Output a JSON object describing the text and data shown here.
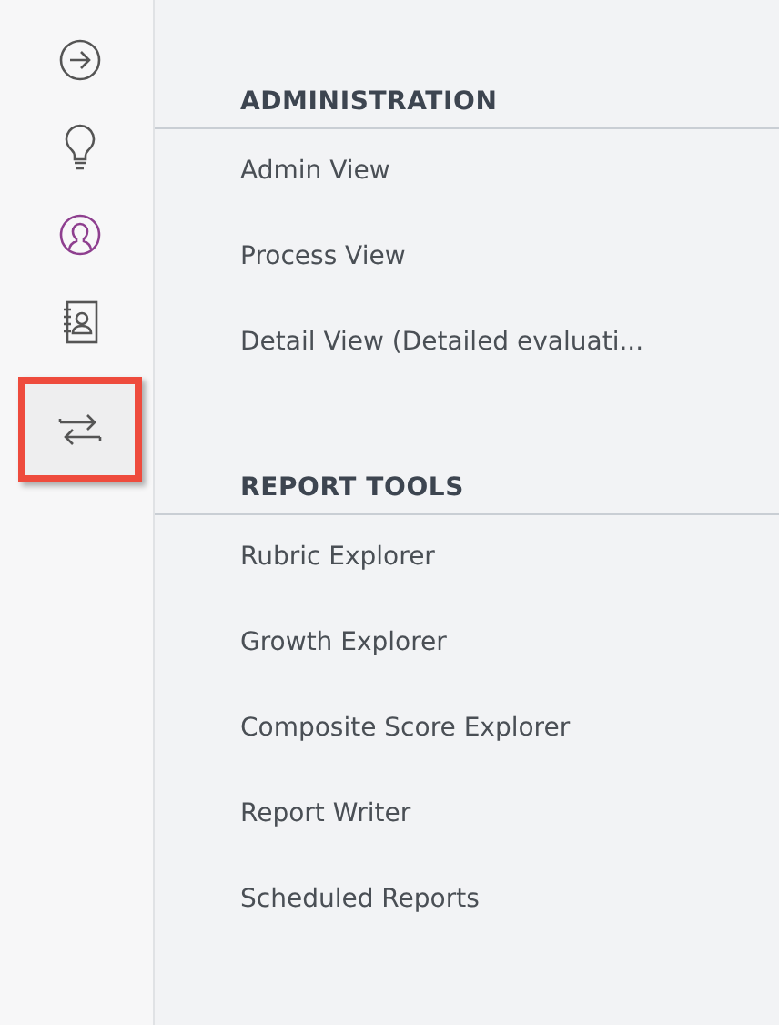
{
  "rail": {
    "items": [
      {
        "kind": "arrow",
        "selected": false
      },
      {
        "kind": "bulb",
        "selected": false
      },
      {
        "kind": "user",
        "selected": false
      },
      {
        "kind": "contacts",
        "selected": false
      },
      {
        "kind": "swap",
        "selected": true
      }
    ]
  },
  "sections": [
    {
      "title": "ADMINISTRATION",
      "items": [
        "Admin View",
        "Process View",
        "Detail View (Detailed evaluati..."
      ]
    },
    {
      "title": "REPORT TOOLS",
      "items": [
        "Rubric Explorer",
        "Growth Explorer",
        "Composite Score Explorer",
        "Report Writer",
        "Scheduled Reports"
      ]
    }
  ]
}
